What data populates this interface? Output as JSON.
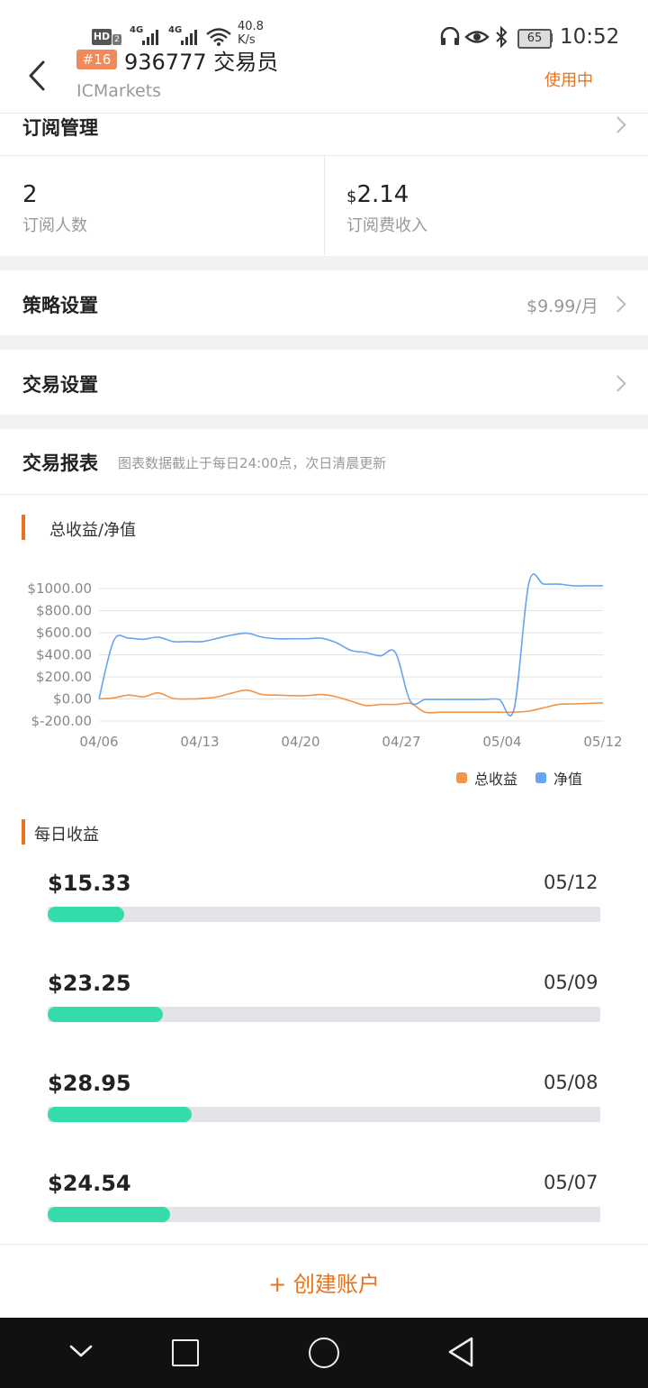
{
  "status_bar": {
    "hd": "HD",
    "hd_sub": "2",
    "sig1": "4G",
    "sig2": "4G",
    "speed_value": "40.8",
    "speed_unit": "K/s",
    "battery": "65",
    "time": "10:52",
    "icons": [
      "headset-icon",
      "eye-icon",
      "bluetooth-icon",
      "battery-icon",
      "wifi-icon",
      "signal-icon"
    ]
  },
  "header": {
    "rank": "#16",
    "title": "936777 交易员",
    "broker": "ICMarkets",
    "status": "使用中"
  },
  "subscription": {
    "label": "订阅管理",
    "subscribers_value": "2",
    "subscribers_label": "订阅人数",
    "income_currency": "$",
    "income_value": "2.14",
    "income_label": "订阅费收入"
  },
  "strategy": {
    "label": "策略设置",
    "price": "$9.99/月"
  },
  "trade_settings": {
    "label": "交易设置"
  },
  "report": {
    "title": "交易报表",
    "note": "图表数据截止于每日24:00点，次日清晨更新",
    "chart_label": "总收益/净值",
    "daily_label": "每日收益"
  },
  "chart_data": {
    "type": "line",
    "ylim": [
      -200,
      1000
    ],
    "ytick_labels": [
      "$1000.00",
      "$800.00",
      "$600.00",
      "$400.00",
      "$200.00",
      "$0.00",
      "$-200.00"
    ],
    "xtick_labels": [
      "04/06",
      "04/13",
      "04/20",
      "04/27",
      "05/04",
      "05/12"
    ],
    "legend_position": "bottom-right",
    "series": [
      {
        "name": "总收益",
        "color": "#f0954a",
        "points": [
          [
            0,
            0
          ],
          [
            1,
            10
          ],
          [
            2,
            35
          ],
          [
            3,
            20
          ],
          [
            4,
            55
          ],
          [
            5,
            5
          ],
          [
            6,
            0
          ],
          [
            7,
            5
          ],
          [
            8,
            20
          ],
          [
            9,
            55
          ],
          [
            10,
            80
          ],
          [
            11,
            40
          ],
          [
            12,
            35
          ],
          [
            13,
            30
          ],
          [
            14,
            30
          ],
          [
            15,
            40
          ],
          [
            16,
            20
          ],
          [
            17,
            -20
          ],
          [
            18,
            -60
          ],
          [
            19,
            -50
          ],
          [
            20,
            -50
          ],
          [
            21,
            -40
          ],
          [
            22,
            -120
          ],
          [
            23,
            -120
          ],
          [
            24,
            -120
          ],
          [
            25,
            -120
          ],
          [
            26,
            -120
          ],
          [
            27,
            -120
          ],
          [
            28,
            -120
          ],
          [
            29,
            -110
          ],
          [
            30,
            -80
          ],
          [
            31,
            -50
          ],
          [
            32,
            -45
          ],
          [
            33,
            -40
          ],
          [
            34,
            -35
          ]
        ]
      },
      {
        "name": "净值",
        "color": "#6aa3ef",
        "points": [
          [
            0,
            0
          ],
          [
            1,
            530
          ],
          [
            2,
            550
          ],
          [
            3,
            540
          ],
          [
            4,
            560
          ],
          [
            5,
            520
          ],
          [
            6,
            520
          ],
          [
            7,
            520
          ],
          [
            8,
            550
          ],
          [
            9,
            580
          ],
          [
            10,
            595
          ],
          [
            11,
            560
          ],
          [
            12,
            545
          ],
          [
            13,
            545
          ],
          [
            14,
            545
          ],
          [
            15,
            550
          ],
          [
            16,
            510
          ],
          [
            17,
            440
          ],
          [
            18,
            420
          ],
          [
            19,
            390
          ],
          [
            20,
            420
          ],
          [
            21,
            -20
          ],
          [
            22,
            -5
          ],
          [
            23,
            -5
          ],
          [
            24,
            -5
          ],
          [
            25,
            -5
          ],
          [
            26,
            -5
          ],
          [
            27,
            -5
          ],
          [
            28,
            -90
          ],
          [
            29,
            1050
          ],
          [
            30,
            1040
          ],
          [
            31,
            1040
          ],
          [
            32,
            1025
          ],
          [
            33,
            1025
          ],
          [
            34,
            1025
          ]
        ]
      }
    ],
    "x_start": "04/06",
    "x_end": "05/12"
  },
  "daily": [
    {
      "amount": "$15.33",
      "date": "05/12",
      "value": 15.33
    },
    {
      "amount": "$23.25",
      "date": "05/09",
      "value": 23.25
    },
    {
      "amount": "$28.95",
      "date": "05/08",
      "value": 28.95
    },
    {
      "amount": "$24.54",
      "date": "05/07",
      "value": 24.54
    }
  ],
  "create_button": "+ 创建账户"
}
